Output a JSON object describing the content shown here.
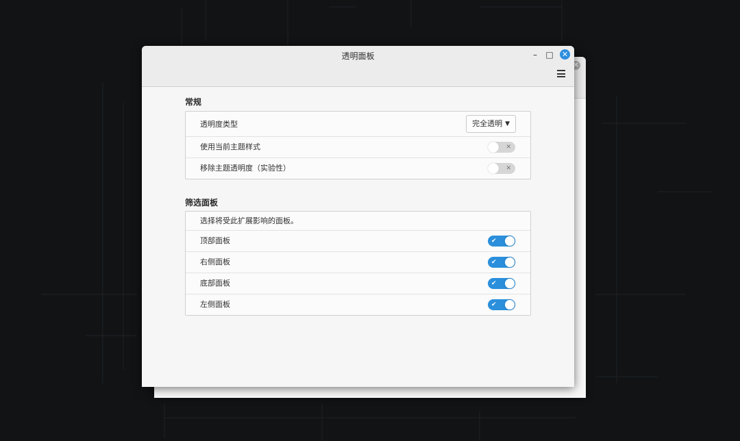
{
  "window": {
    "title": "透明面板",
    "minimize_icon": "–",
    "maximize_icon": "□",
    "close_icon": "✕"
  },
  "sections": {
    "general": {
      "title": "常规",
      "opacity_type_label": "透明度类型",
      "opacity_type_value": "完全透明",
      "use_theme_style_label": "使用当前主题样式",
      "use_theme_style_on": false,
      "remove_theme_opacity_label": "移除主题透明度（实验性）",
      "remove_theme_opacity_on": false
    },
    "filter": {
      "title": "筛选面板",
      "description": "选择将受此扩展影响的面板。",
      "top_label": "顶部面板",
      "top_on": true,
      "right_label": "右侧面板",
      "right_on": true,
      "bottom_label": "底部面板",
      "bottom_on": true,
      "left_label": "左侧面板",
      "left_on": true
    }
  },
  "icons": {
    "toggle_on_mark": "✔",
    "toggle_off_mark": "✕",
    "dropdown_arrow": "▼"
  },
  "colors": {
    "accent": "#2b8fdb",
    "close_button": "#2e8ee0",
    "desktop_background": "#111315"
  }
}
